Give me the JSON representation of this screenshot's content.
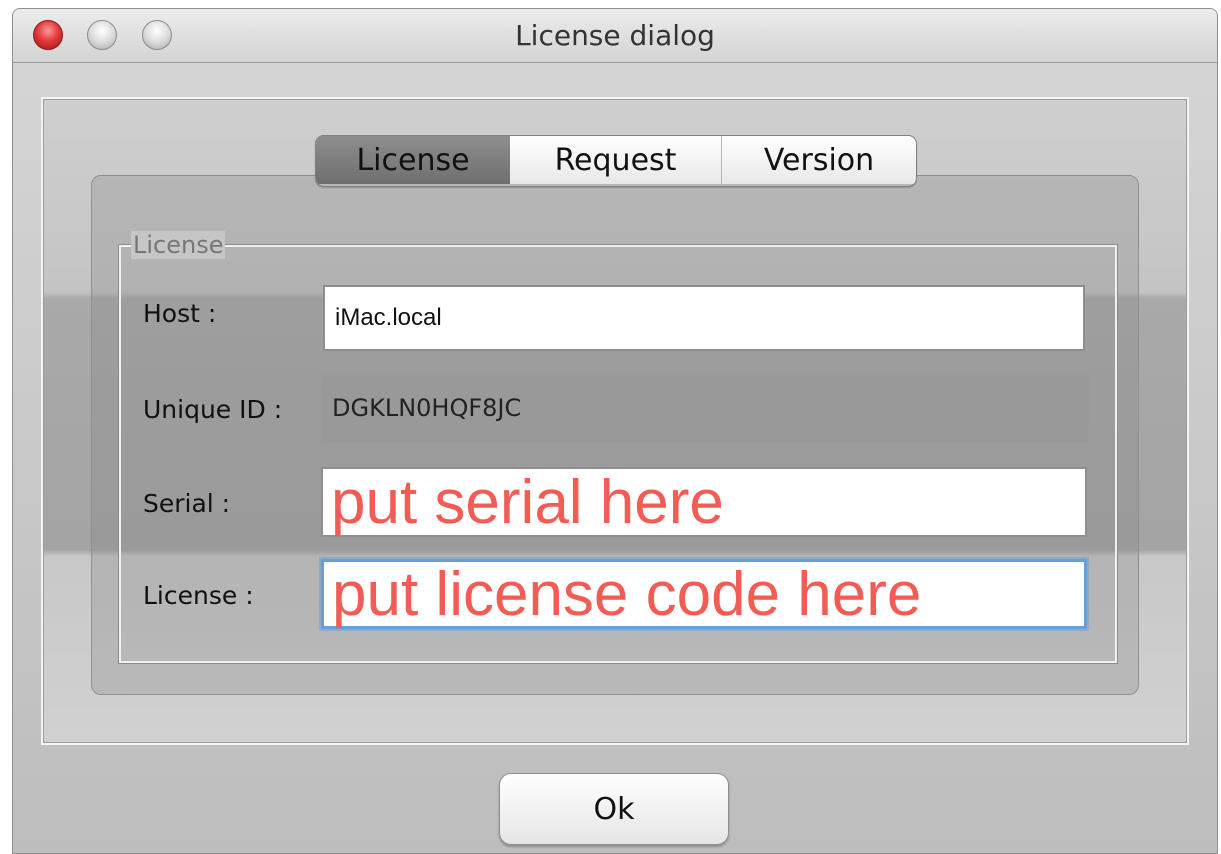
{
  "window": {
    "title": "License dialog"
  },
  "tabs": [
    {
      "label": "License",
      "active": true
    },
    {
      "label": "Request",
      "active": false
    },
    {
      "label": "Version",
      "active": false
    }
  ],
  "group": {
    "title": "License"
  },
  "form": {
    "host_label": "Host :",
    "host_value": "iMac.local",
    "unique_id_label": "Unique ID :",
    "unique_id_value": "DGKLN0HQF8JC",
    "serial_label": "Serial :",
    "serial_value": "put serial here",
    "license_label": "License :",
    "license_value": "put license code here"
  },
  "buttons": {
    "ok_label": "Ok"
  },
  "colors": {
    "hint_text": "#f25c54",
    "focus_ring": "#6a9fd6"
  }
}
